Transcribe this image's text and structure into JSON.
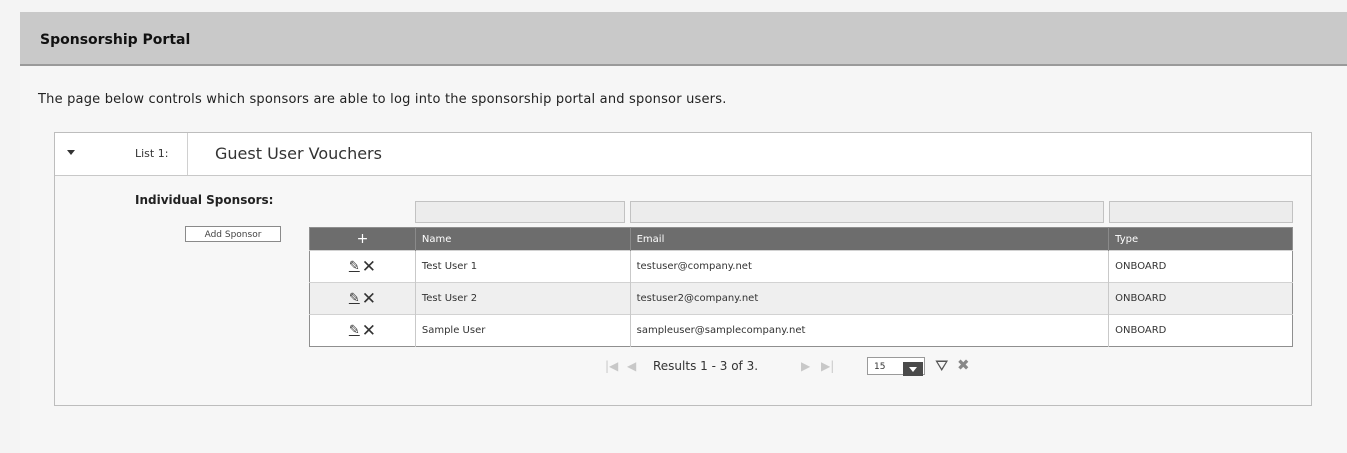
{
  "header": {
    "title": "Sponsorship Portal"
  },
  "intro": "The page below controls which sponsors are able to log into the sponsorship portal and sponsor users.",
  "list": {
    "label": "List 1:",
    "name": "Guest User Vouchers",
    "sponsors_label": "Individual Sponsors:",
    "add_sponsor_label": "Add Sponsor"
  },
  "table": {
    "columns": {
      "actions": "+",
      "name": "Name",
      "email": "Email",
      "type": "Type"
    },
    "rows": [
      {
        "name": "Test User 1",
        "email": "testuser@company.net",
        "type": "ONBOARD"
      },
      {
        "name": "Test User 2",
        "email": "testuser2@company.net",
        "type": "ONBOARD"
      },
      {
        "name": "Sample User",
        "email": "sampleuser@samplecompany.net",
        "type": "ONBOARD"
      }
    ]
  },
  "pager": {
    "results_text": "Results 1 - 3 of 3.",
    "page_size": "15"
  },
  "icons": {
    "edit": "pencil-icon",
    "delete": "x-icon",
    "filter": "funnel-icon",
    "clear_filter": "clear-filter-icon"
  },
  "colors": {
    "header_bg": "#c9c9c9",
    "table_header_bg": "#6d6d6d",
    "row_alt_bg": "#efefef"
  }
}
